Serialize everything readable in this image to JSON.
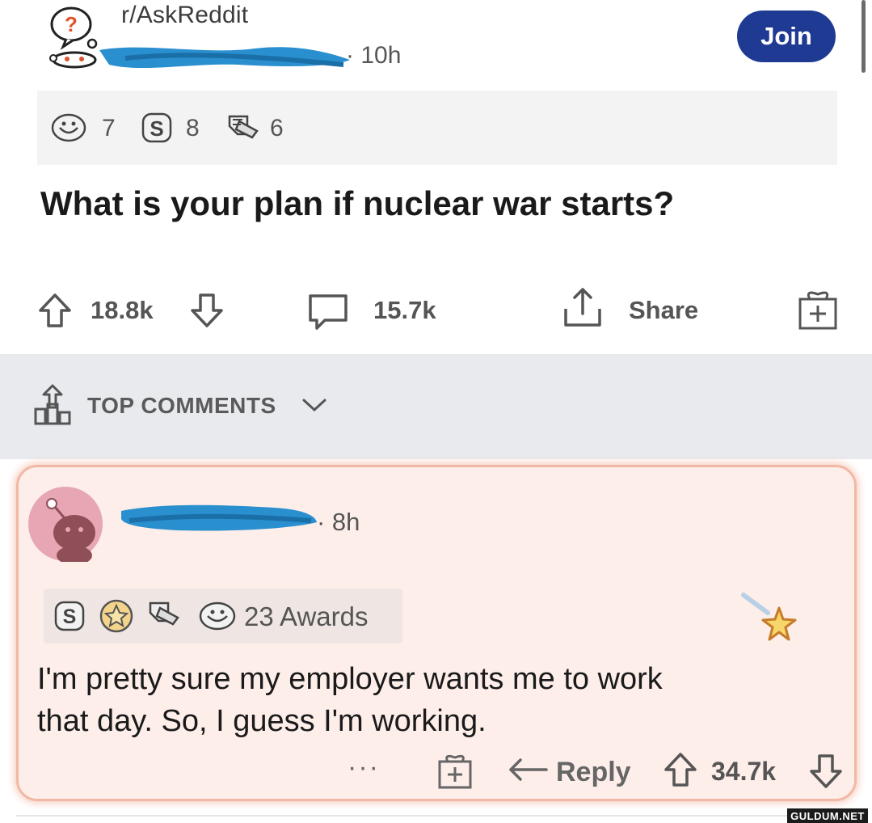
{
  "post": {
    "subreddit": "r/AskReddit",
    "time": "· 10h",
    "join_label": "Join",
    "awards": [
      {
        "icon": "wholesome-icon",
        "count": "7"
      },
      {
        "icon": "silver-icon",
        "count": "8"
      },
      {
        "icon": "helpful-icon",
        "count": "6"
      }
    ],
    "title": "What is your plan if nuclear war starts?",
    "upvotes": "18.8k",
    "comments": "15.7k",
    "share_label": "Share"
  },
  "sort": {
    "label": "TOP COMMENTS"
  },
  "comment": {
    "time": "· 8h",
    "awards_label": "23 Awards",
    "body_line1": "I'm pretty sure my employer wants me to work",
    "body_line2": "that day. So, I guess I'm working.",
    "more": "···",
    "reply_label": "Reply",
    "score": "34.7k"
  },
  "watermark": "GULDUM.NET",
  "colors": {
    "join": "#1f3a93",
    "comment_bg": "#fdeeea",
    "comment_border": "#f1b8a6",
    "sort_bar": "#e9eaee"
  }
}
